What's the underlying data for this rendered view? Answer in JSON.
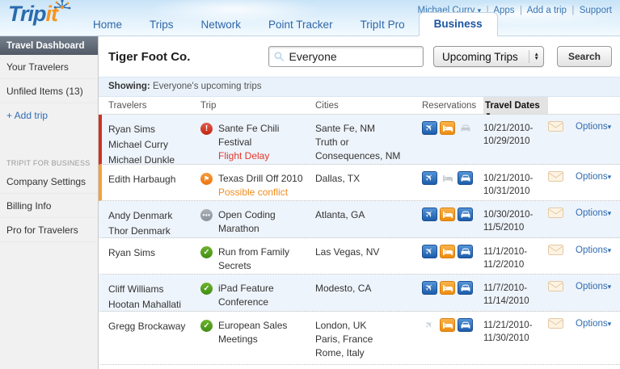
{
  "header": {
    "logo": {
      "part1": "Trip",
      "part2": "it"
    },
    "user_menu": "Michael Curry",
    "links": [
      "Apps",
      "Add a trip",
      "Support"
    ],
    "tabs": [
      "Home",
      "Trips",
      "Network",
      "Point Tracker",
      "TripIt Pro",
      "Business"
    ],
    "active_tab": "Business"
  },
  "sidebar": {
    "items": [
      "Travel Dashboard",
      "Your Travelers",
      "Unfiled Items (13)",
      "+ Add trip"
    ],
    "section": "TRIPIT FOR BUSINESS",
    "section_items": [
      "Company Settings",
      "Billing Info",
      "Pro for Travelers"
    ]
  },
  "toolbar": {
    "company": "Tiger Foot Co.",
    "search_value": "Everyone",
    "filter_value": "Upcoming Trips",
    "search_button": "Search"
  },
  "showing": {
    "label": "Showing:",
    "text": "Everyone's upcoming trips"
  },
  "icons": {
    "user_caret": "▾",
    "sort_desc": "▼",
    "options_caret": "▾",
    "alert": "!",
    "flag": "⚑",
    "dots": "•••",
    "check": "✓",
    "plane": "✈"
  },
  "table": {
    "headers": {
      "travelers": "Travelers",
      "trip": "Trip",
      "cities": "Cities",
      "reservations": "Reservations",
      "travel_dates": "Travel Dates"
    },
    "rows": [
      {
        "travelers": [
          "Ryan Sims",
          "Michael Curry",
          "Michael Dunkle"
        ],
        "status": "alert",
        "trip": "Sante Fe Chili Festival",
        "note": "Flight Delay",
        "cities": [
          "Sante Fe, NM",
          "Truth or Consequences, NM"
        ],
        "reservations": {
          "flight": "active",
          "hotel": "active",
          "car": "inactive"
        },
        "dates": [
          "10/21/2010-",
          "10/29/2010"
        ],
        "options": "Options"
      },
      {
        "travelers": [
          "Edith Harbaugh"
        ],
        "status": "conflict",
        "trip": "Texas Drill Off 2010",
        "note": "Possible conflict",
        "cities": [
          "Dallas, TX"
        ],
        "reservations": {
          "flight": "active",
          "hotel": "inactive",
          "car": "active"
        },
        "dates": [
          "10/21/2010-",
          "10/31/2010"
        ],
        "options": "Options"
      },
      {
        "travelers": [
          "Andy Denmark",
          "Thor Denmark"
        ],
        "status": "pending",
        "trip": "Open Coding Marathon",
        "cities": [
          "Atlanta, GA"
        ],
        "reservations": {
          "flight": "active",
          "hotel": "active",
          "car": "active"
        },
        "dates": [
          "10/30/2010-",
          "11/5/2010"
        ],
        "options": "Options"
      },
      {
        "travelers": [
          "Ryan Sims"
        ],
        "status": "ok",
        "trip": "Run from Family Secrets",
        "cities": [
          "Las Vegas, NV"
        ],
        "reservations": {
          "flight": "active",
          "hotel": "active",
          "car": "active"
        },
        "dates": [
          "11/1/2010-",
          "11/2/2010"
        ],
        "options": "Options"
      },
      {
        "travelers": [
          "Cliff Williams",
          "Hootan Mahallati"
        ],
        "status": "ok",
        "trip": "iPad Feature Conference",
        "cities": [
          "Modesto, CA"
        ],
        "reservations": {
          "flight": "active",
          "hotel": "active",
          "car": "active"
        },
        "dates": [
          "11/7/2010-",
          "11/14/2010"
        ],
        "options": "Options"
      },
      {
        "travelers": [
          "Gregg Brockaway"
        ],
        "status": "ok",
        "trip": "European Sales Meetings",
        "cities": [
          "London, UK",
          "Paris, France",
          "Rome, Italy"
        ],
        "reservations": {
          "flight": "inactive",
          "hotel": "active",
          "car": "active"
        },
        "dates": [
          "11/21/2010-",
          "11/30/2010"
        ],
        "options": "Options"
      }
    ]
  }
}
